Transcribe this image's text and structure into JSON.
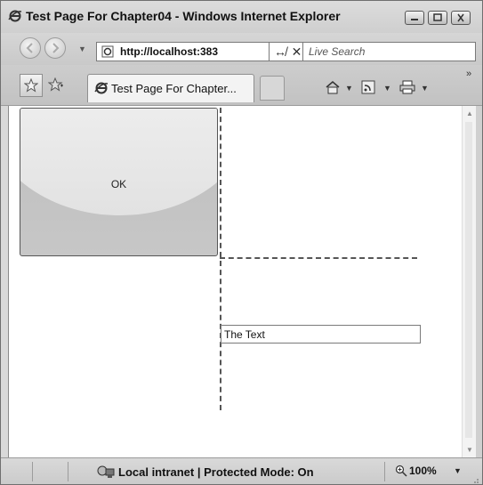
{
  "window": {
    "title": "Test Page For Chapter04 - Windows Internet Explorer"
  },
  "navigation": {
    "address": "http://localhost:383",
    "search_placeholder": "Live Search",
    "refresh_glyph": "↮",
    "stop_glyph": "✕"
  },
  "tabs": [
    {
      "label": "Test Page For Chapter..."
    }
  ],
  "page": {
    "ok_button_label": "OK",
    "textbox_value": "The Text"
  },
  "status": {
    "zone_text": "Local intranet | Protected Mode: On",
    "zoom": "100%"
  },
  "icons": {
    "ie_logo": "ie-logo-icon",
    "back": "back-arrow-icon",
    "forward": "forward-arrow-icon",
    "favorites": "star-icon",
    "add_favorites": "add-favorite-icon",
    "home": "home-icon",
    "feeds": "feeds-icon",
    "print": "printer-icon",
    "zone": "intranet-icon",
    "zoom": "magnifier-icon"
  }
}
